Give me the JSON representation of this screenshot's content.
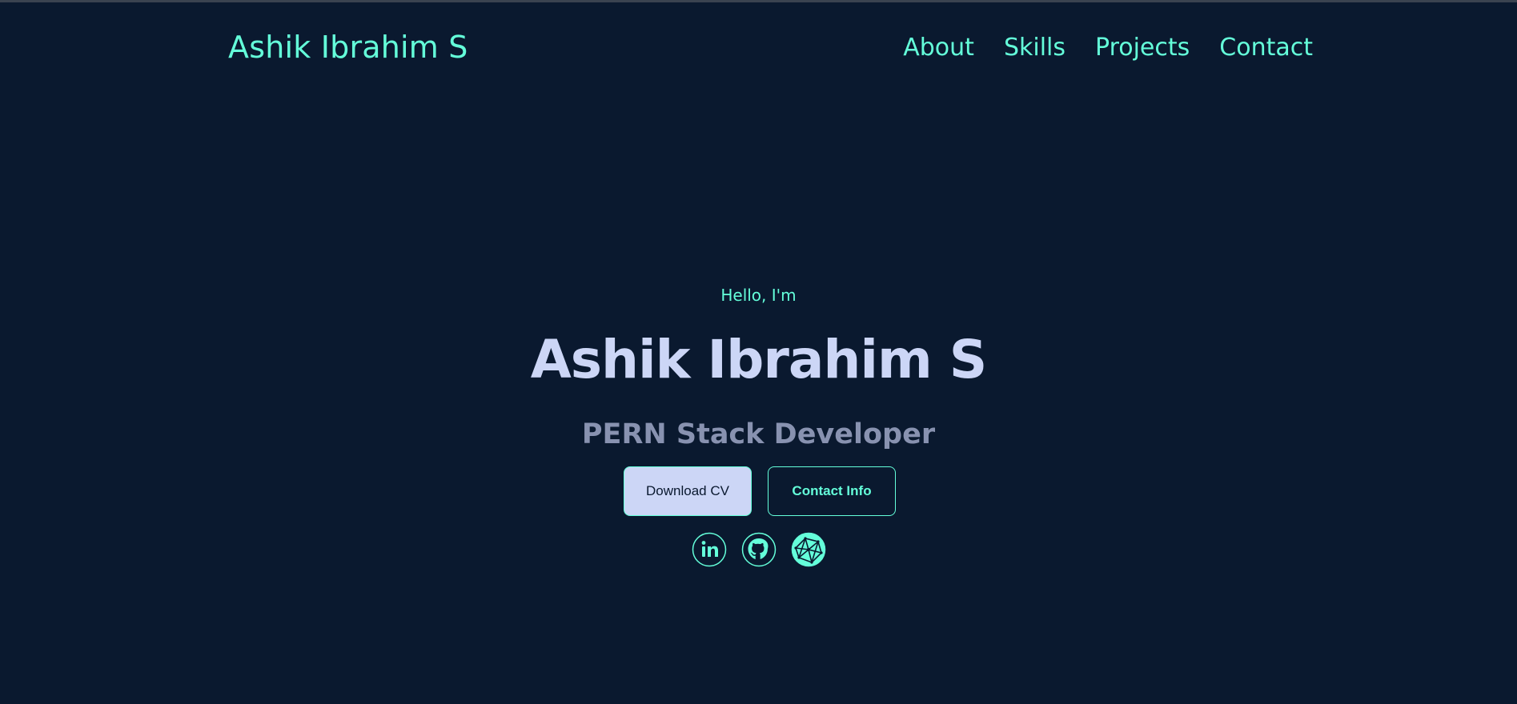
{
  "header": {
    "brand": "Ashik Ibrahim S",
    "nav": [
      {
        "label": "About"
      },
      {
        "label": "Skills"
      },
      {
        "label": "Projects"
      },
      {
        "label": "Contact"
      }
    ]
  },
  "hero": {
    "greeting": "Hello, I'm",
    "name": "Ashik Ibrahim S",
    "role": "PERN Stack Developer",
    "buttons": {
      "download": "Download CV",
      "contact": "Contact Info"
    },
    "social_icons": [
      "linkedin-icon",
      "github-icon",
      "website-icon"
    ]
  },
  "colors": {
    "background": "#0a192f",
    "accent": "#64ffda",
    "heading": "#ccd6f6",
    "muted": "#8892b0"
  }
}
